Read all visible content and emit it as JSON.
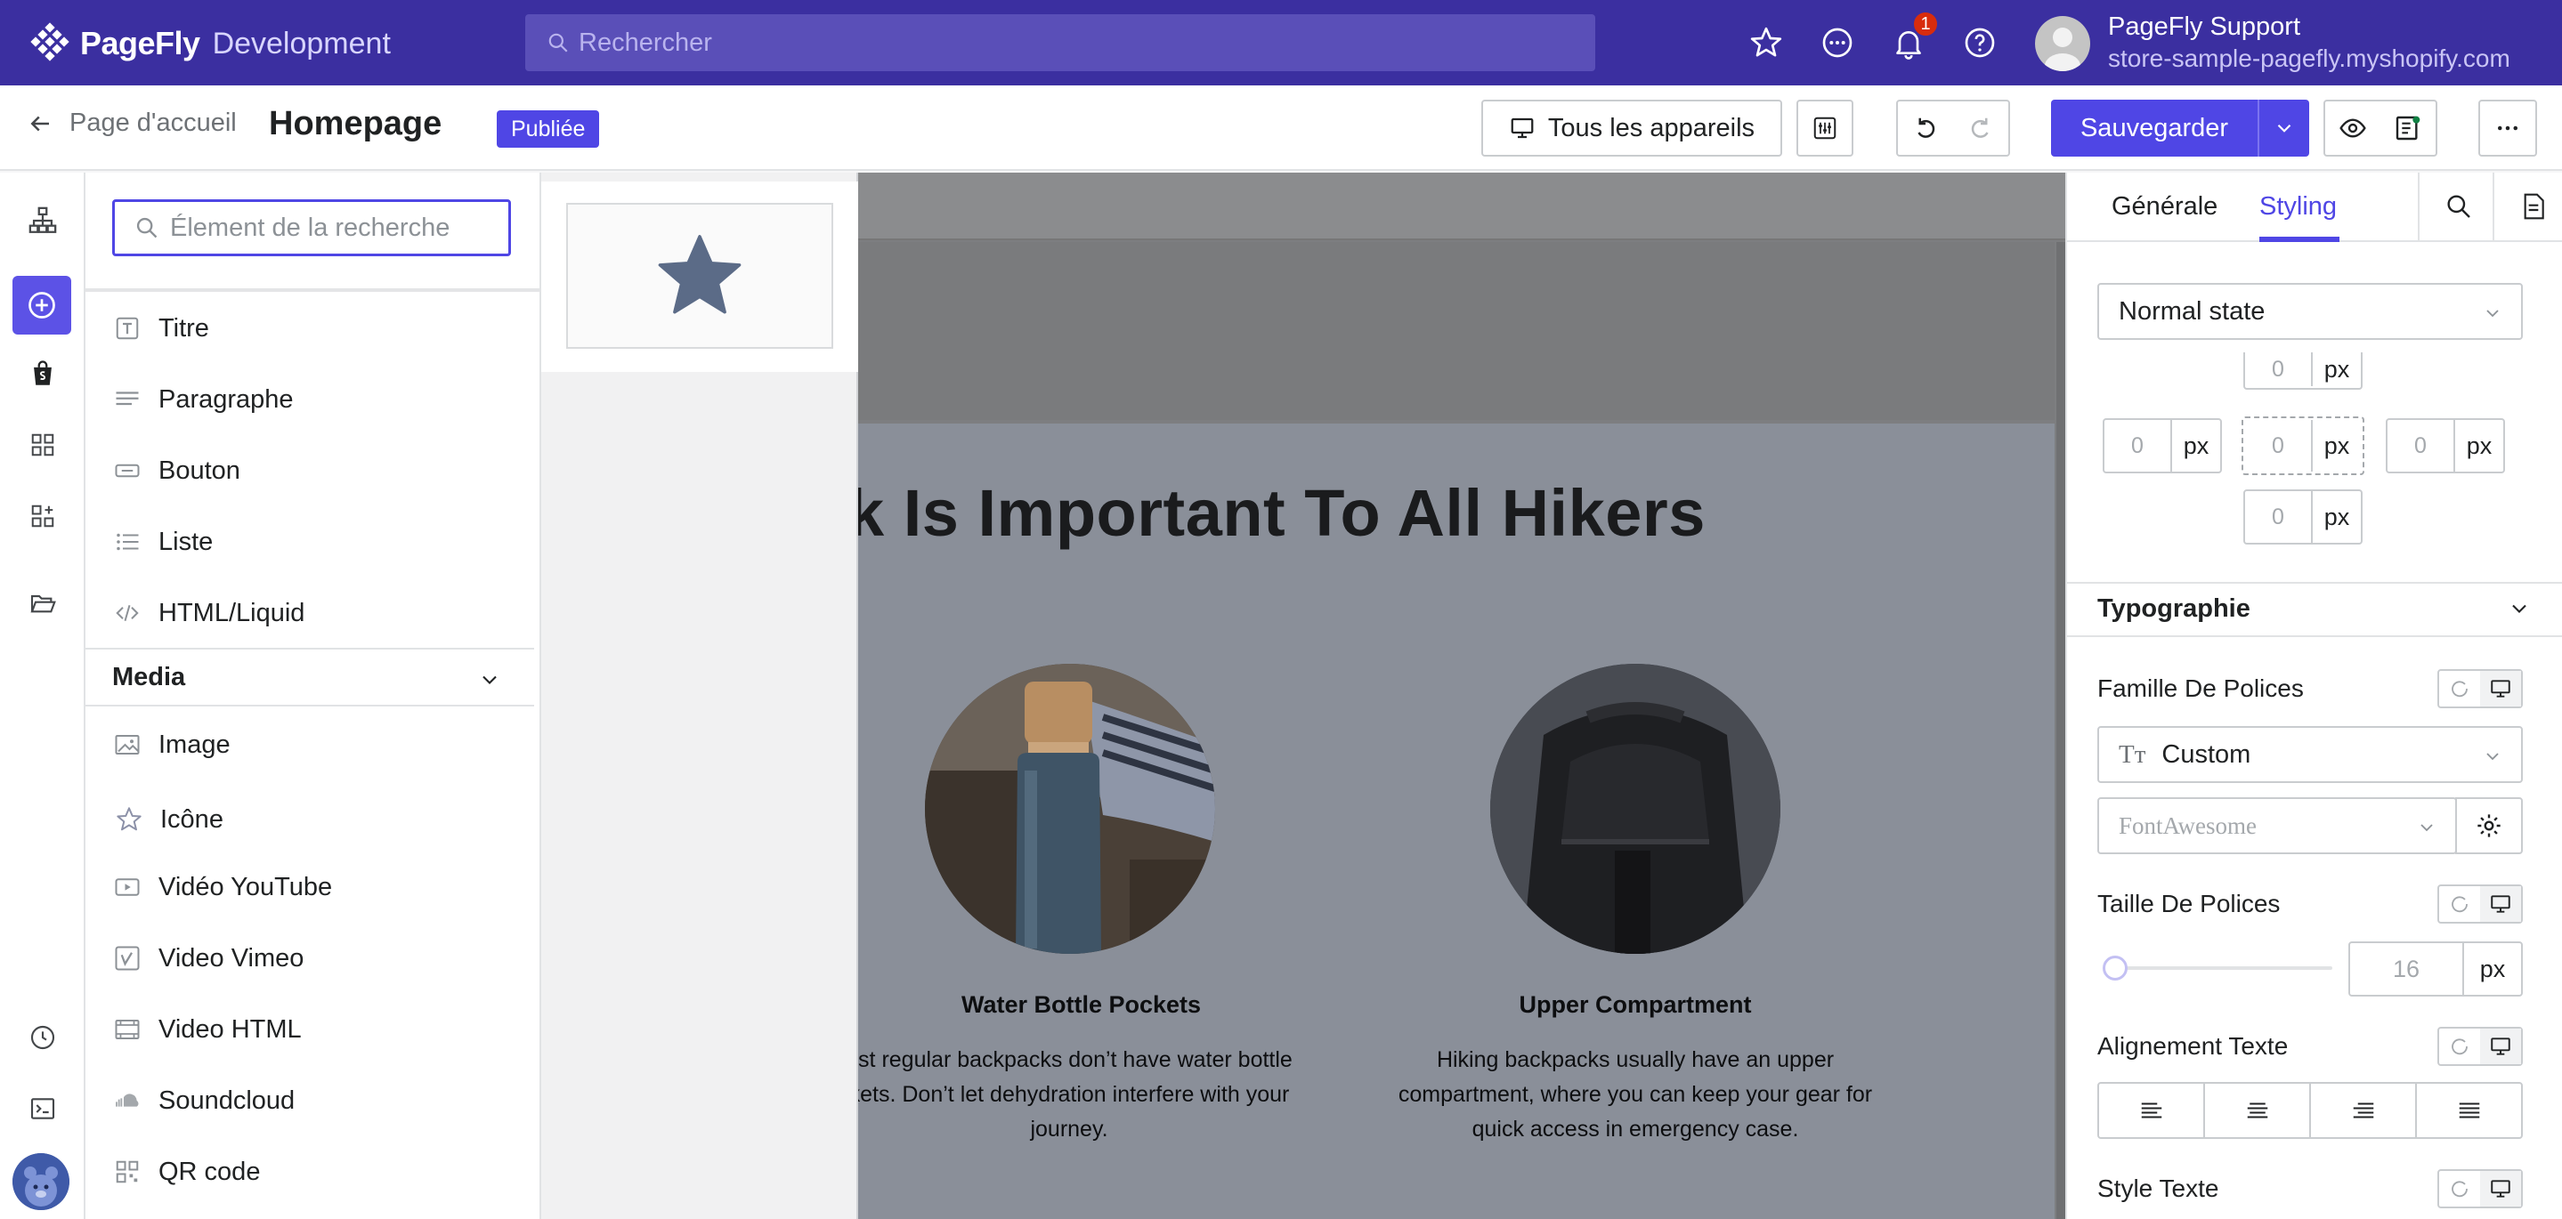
{
  "topbar": {
    "brand": "PageFly",
    "brand_suffix": "Development",
    "search_placeholder": "Rechercher",
    "notification_count": "1",
    "user_name": "PageFly Support",
    "user_store": "store-sample-pagefly.myshopify.com"
  },
  "subbar": {
    "back_label": "Page d'accueil",
    "page_title": "Homepage",
    "status_badge": "Publiée",
    "devices_label": "Tous les appareils",
    "save_label": "Sauvegarder"
  },
  "element_panel": {
    "search_placeholder": "Élement de la recherche",
    "basic_items": [
      {
        "label": "Titre",
        "icon": "heading-icon"
      },
      {
        "label": "Paragraphe",
        "icon": "paragraph-icon"
      },
      {
        "label": "Bouton",
        "icon": "button-icon"
      },
      {
        "label": "Liste",
        "icon": "list-icon"
      },
      {
        "label": "HTML/Liquid",
        "icon": "code-icon"
      }
    ],
    "media_category": "Media",
    "media_items": [
      {
        "label": "Image",
        "icon": "image-icon"
      },
      {
        "label": "Icône",
        "icon": "star-outline-icon"
      },
      {
        "label": "Vidéo YouTube",
        "icon": "youtube-icon"
      },
      {
        "label": "Video Vimeo",
        "icon": "vimeo-icon"
      },
      {
        "label": "Video HTML",
        "icon": "video-icon"
      },
      {
        "label": "Soundcloud",
        "icon": "soundcloud-icon"
      },
      {
        "label": "QR code",
        "icon": "qr-code-icon"
      }
    ],
    "active_item": "Icône"
  },
  "canvas": {
    "hero_title": "k Is Important To All Hikers",
    "features": [
      {
        "title": "Water Bottle Pockets",
        "text_lines": [
          "ost regular backpacks don’t have water bottle",
          "kets. Don’t let dehydration interfere with your",
          "journey."
        ]
      },
      {
        "title": "Upper Compartment",
        "text_lines": [
          "Hiking backpacks usually have an upper",
          "compartment, where you can keep your gear for",
          "quick access in emergency case."
        ]
      }
    ]
  },
  "right_panel": {
    "tabs": [
      "Générale",
      "Styling"
    ],
    "active_tab": "Styling",
    "state_select": "Normal state",
    "spacing": {
      "top": "0",
      "left": "0",
      "center": "0",
      "right": "0",
      "bottom": "0",
      "unit": "px"
    },
    "typography_title": "Typographie",
    "font_family_label": "Famille De Polices",
    "font_family_value": "Custom",
    "font_family_prefix": "Tт",
    "font_custom_value": "FontAwesome",
    "font_size_label": "Taille De Polices",
    "font_size_value": "16",
    "font_size_unit": "px",
    "text_align_label": "Alignement Texte",
    "text_style_label": "Style Texte"
  },
  "colors": {
    "topbar_bg": "#3b2fa0",
    "accent": "#4f46e5",
    "badge_red": "#d82c0d"
  }
}
